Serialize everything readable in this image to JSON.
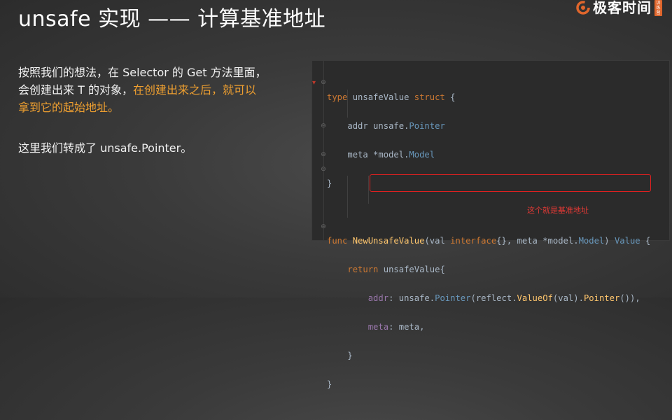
{
  "slide": {
    "title": "unsafe 实现 —— 计算基准地址",
    "logo_text": "极客时间",
    "logo_badge": "训练营"
  },
  "body": {
    "p1_a": "按照我们的想法，在 Selector 的 Get 方法里面，",
    "p1_b": "会创建出来 T 的对象，",
    "p1_hl_a": "在创建出来之后，就可以",
    "p1_hl_b": "拿到它的起始地址。",
    "p2": "这里我们转成了 unsafe.Pointer。"
  },
  "code": {
    "l1": {
      "kw": "type",
      "name": " unsafeValue ",
      "kw2": "struct",
      "rest": " {"
    },
    "l2": {
      "field": "addr",
      "pkg": " unsafe.",
      "type": "Pointer"
    },
    "l3": {
      "field": "meta",
      "star": " *model.",
      "type": "Model"
    },
    "l4": "}",
    "l6": {
      "kw": "func",
      "fn": "NewUnsafeValue",
      "p1": "(val ",
      "kw2": "interface",
      "p2": "{}, meta *model.",
      "ty": "Model",
      "p3": ") ",
      "ret": "Value",
      "p4": " {"
    },
    "l7": {
      "kw": "return",
      "rest": " unsafeValue{"
    },
    "l8": {
      "field": "addr",
      "a": ": unsafe.",
      "ty": "Pointer",
      "b": "(reflect.",
      "fn": "ValueOf",
      "c": "(val).",
      "fn2": "Pointer",
      "d": "()),"
    },
    "l9": {
      "field": "meta",
      "rest": ": meta,"
    },
    "l10": "}",
    "l11": "}"
  },
  "annotation": {
    "note": "这个就是基准地址"
  },
  "colors": {
    "highlight": "#f0a030",
    "annotation_red": "#e02020",
    "code_bg": "#2b2b2b"
  }
}
